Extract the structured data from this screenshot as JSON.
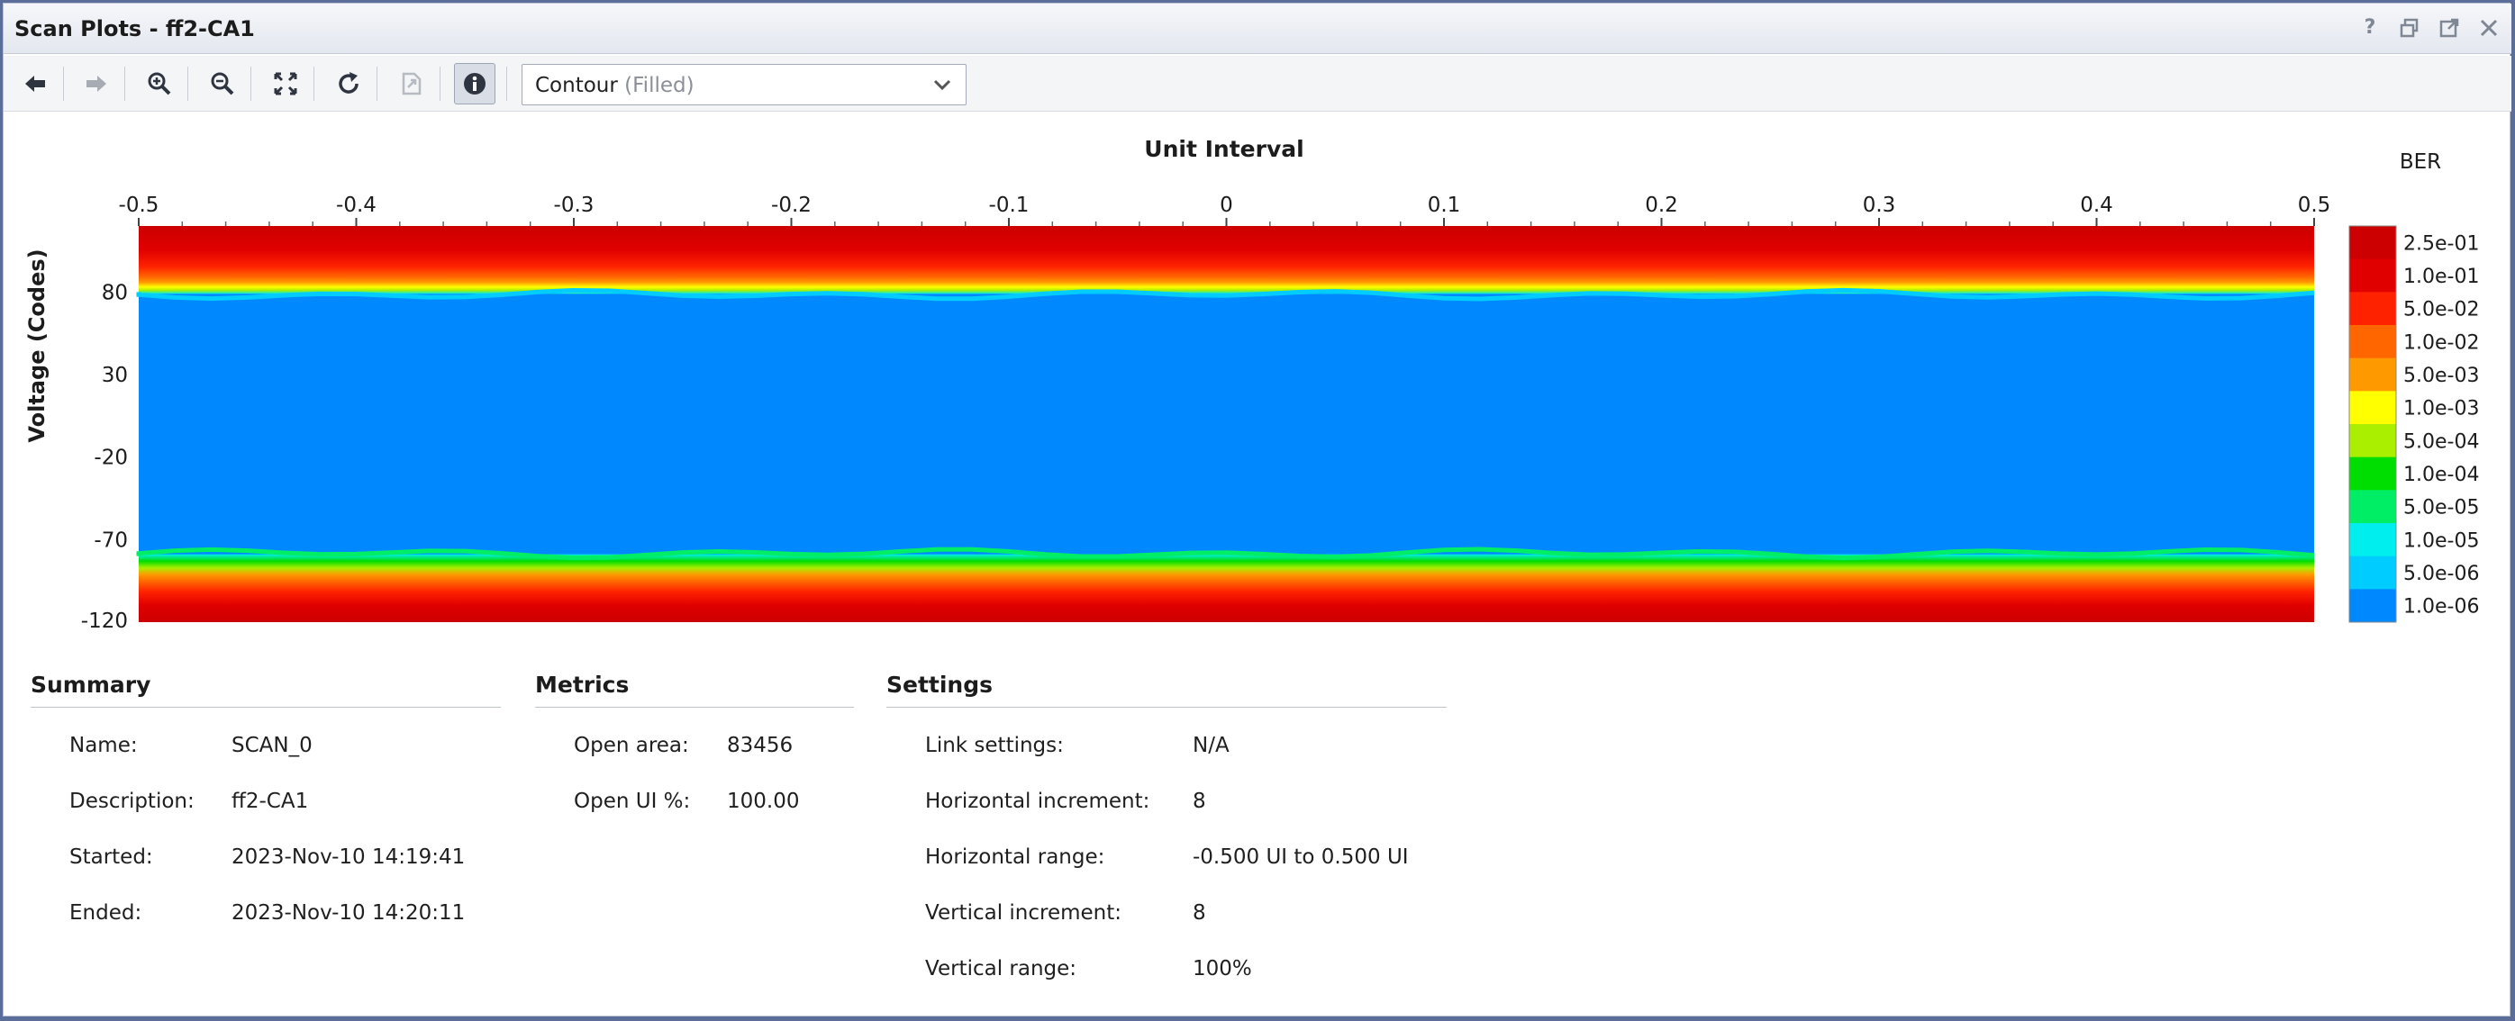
{
  "window": {
    "title": "Scan Plots - ff2-CA1",
    "controls": [
      "help-icon",
      "restore-icon",
      "float-icon",
      "close-icon"
    ]
  },
  "toolbar": {
    "buttons": [
      "back-icon",
      "forward-icon",
      "zoom-in-icon",
      "zoom-out-icon",
      "fit-icon",
      "refresh-icon",
      "export-icon",
      "info-icon"
    ],
    "plot_type": "Contour",
    "plot_subtype": "(Filled)"
  },
  "chart_data": {
    "type": "heatmap",
    "title": "Unit Interval",
    "ylabel": "Voltage (Codes)",
    "x_ticks": [
      "-0.5",
      "-0.4",
      "-0.3",
      "-0.2",
      "-0.1",
      "0",
      "0.1",
      "0.2",
      "0.3",
      "0.4",
      "0.5"
    ],
    "y_ticks": [
      "80",
      "30",
      "-20",
      "-70",
      "-120"
    ],
    "xlim": [
      -0.5,
      0.5
    ],
    "ylim": [
      -120,
      120
    ],
    "colorbar_title": "BER",
    "colorbar": [
      {
        "label": "2.5e-01",
        "color": "#cc0000"
      },
      {
        "label": "1.0e-01",
        "color": "#e00000"
      },
      {
        "label": "5.0e-02",
        "color": "#ff2200"
      },
      {
        "label": "1.0e-02",
        "color": "#ff6600"
      },
      {
        "label": "5.0e-03",
        "color": "#ff9900"
      },
      {
        "label": "1.0e-03",
        "color": "#ffff00"
      },
      {
        "label": "5.0e-04",
        "color": "#aaee00"
      },
      {
        "label": "1.0e-04",
        "color": "#00dd00"
      },
      {
        "label": "5.0e-05",
        "color": "#00ee66"
      },
      {
        "label": "1.0e-05",
        "color": "#00eeee"
      },
      {
        "label": "5.0e-06",
        "color": "#00ccff"
      },
      {
        "label": "1.0e-06",
        "color": "#0088ff"
      }
    ],
    "eye_top_code": 80,
    "eye_bottom_code": -80
  },
  "summary": {
    "heading": "Summary",
    "rows": [
      {
        "label": "Name:",
        "value": "SCAN_0"
      },
      {
        "label": "Description:",
        "value": "ff2-CA1"
      },
      {
        "label": "Started:",
        "value": "2023-Nov-10 14:19:41"
      },
      {
        "label": "Ended:",
        "value": "2023-Nov-10 14:20:11"
      }
    ]
  },
  "metrics": {
    "heading": "Metrics",
    "rows": [
      {
        "label": "Open area:",
        "value": "83456"
      },
      {
        "label": "Open UI %:",
        "value": "100.00"
      }
    ]
  },
  "settings": {
    "heading": "Settings",
    "rows": [
      {
        "label": "Link settings:",
        "value": "N/A"
      },
      {
        "label": "Horizontal increment:",
        "value": "8"
      },
      {
        "label": "Horizontal range:",
        "value": "-0.500 UI to 0.500 UI"
      },
      {
        "label": "Vertical increment:",
        "value": "8"
      },
      {
        "label": "Vertical range:",
        "value": "100%"
      }
    ]
  }
}
